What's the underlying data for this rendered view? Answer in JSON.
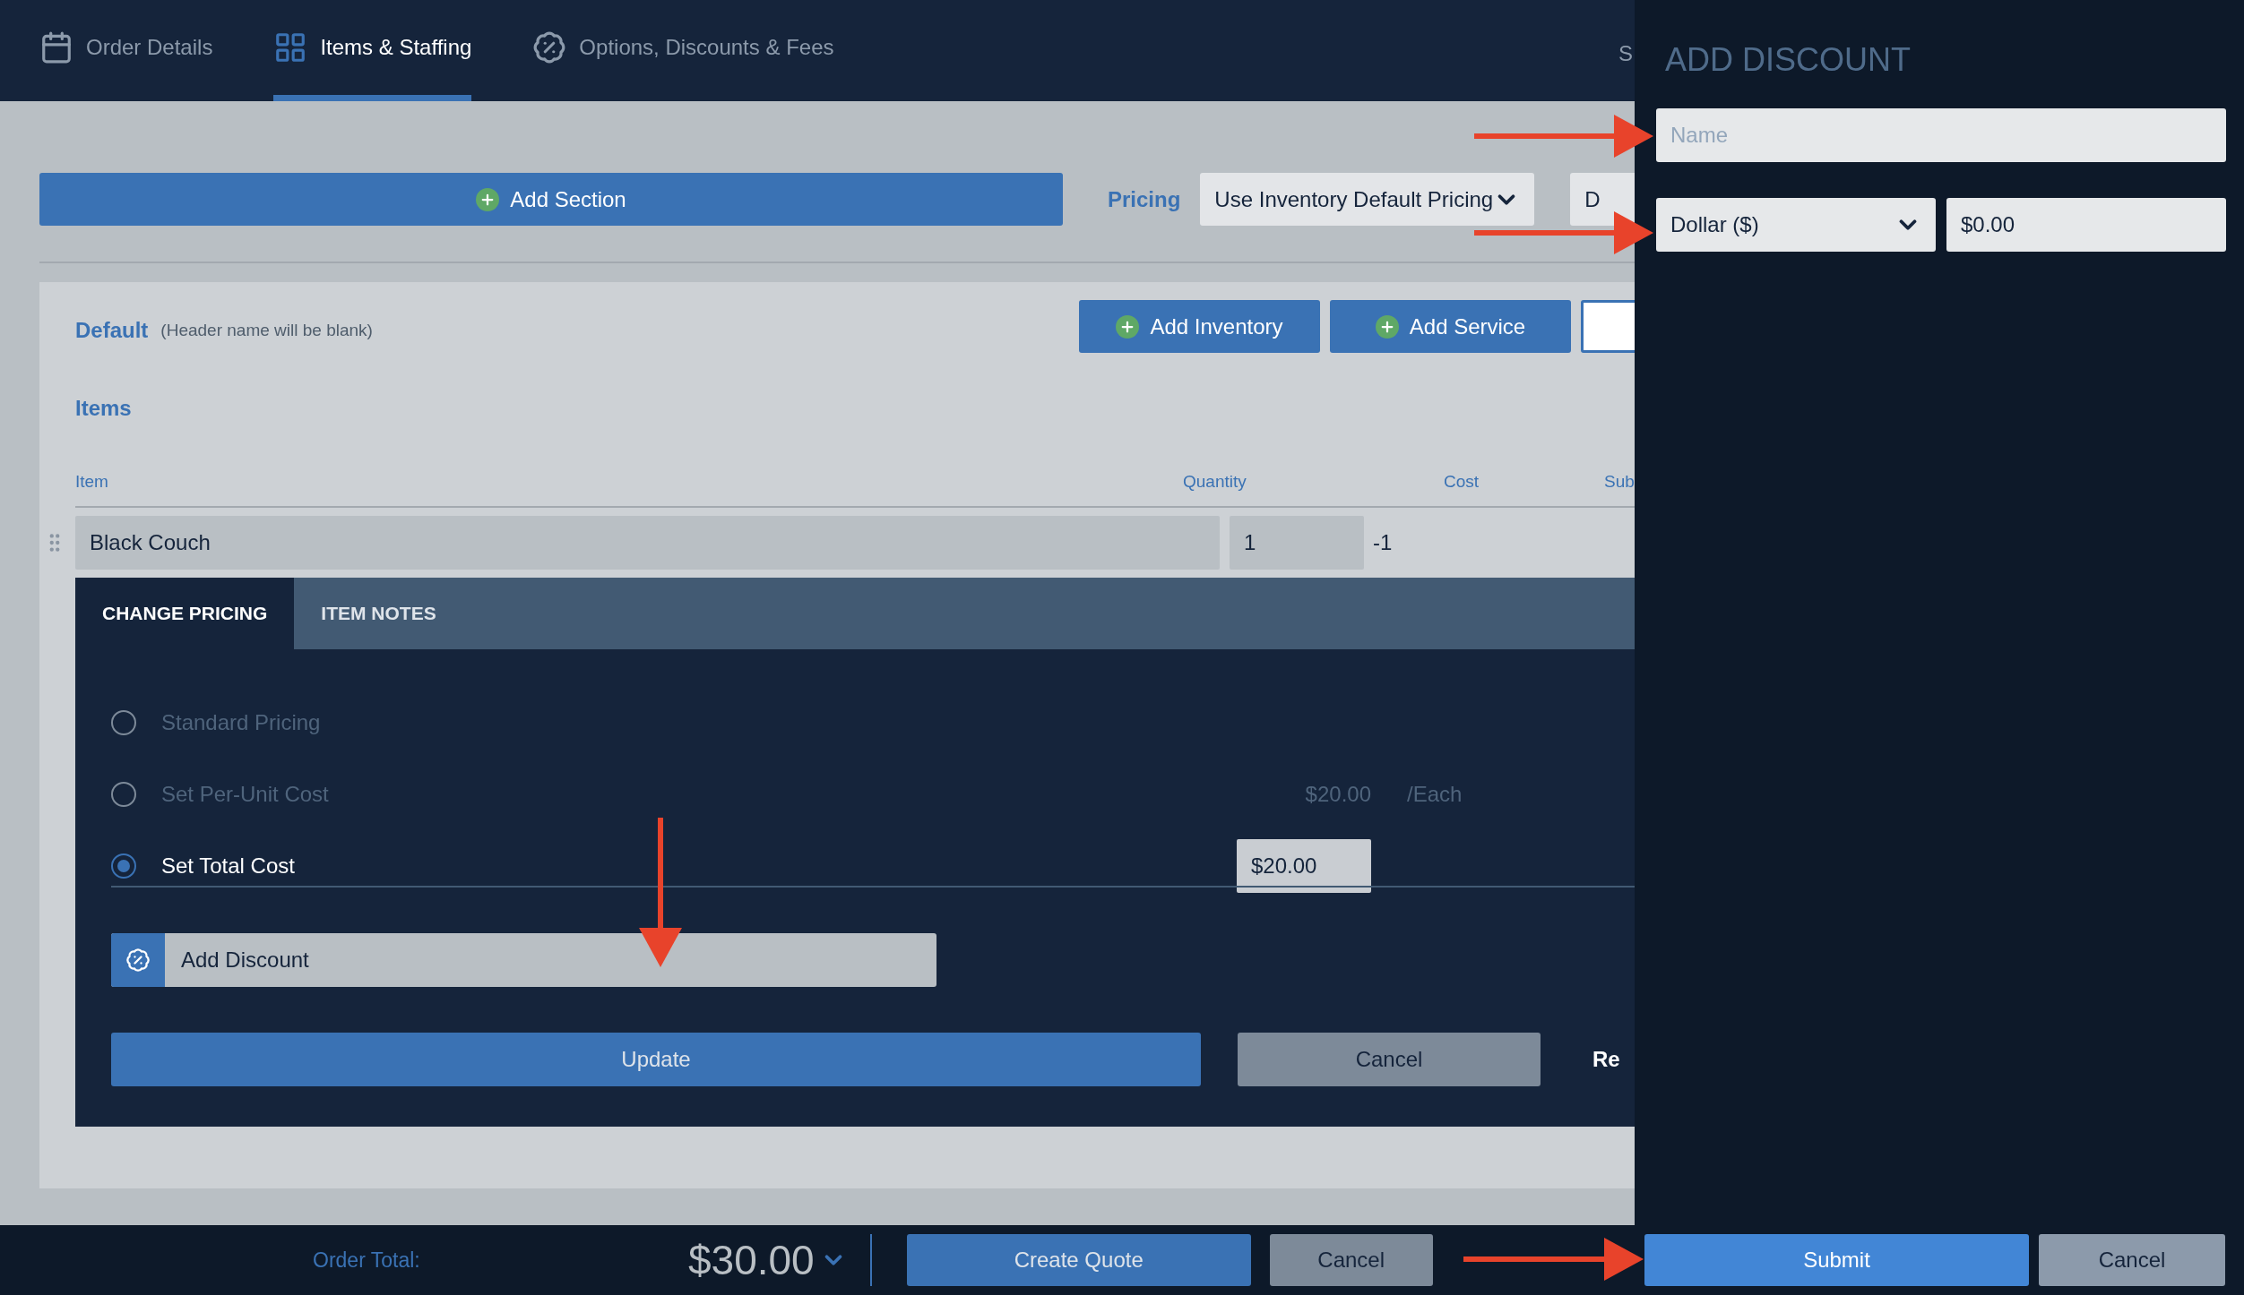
{
  "nav_tabs": [
    {
      "label": "Order Details",
      "selected": false
    },
    {
      "label": "Items & Staffing",
      "selected": true
    },
    {
      "label": "Options, Discounts & Fees",
      "selected": false
    }
  ],
  "nav_tab_cut": "S",
  "toolbar": {
    "add_section": "Add Section",
    "pricing_label": "Pricing",
    "pricing_select": "Use Inventory Default Pricing",
    "cut_box": "D"
  },
  "section": {
    "name": "Default",
    "note": "(Header name will be blank)",
    "buttons": [
      "Add Inventory",
      "Add Service"
    ],
    "items_heading": "Items",
    "columns": [
      "Item",
      "Quantity",
      "Cost",
      "Sub"
    ],
    "row": {
      "item": "Black Couch",
      "quantity": "1",
      "cost": "-1"
    }
  },
  "pricing_panel": {
    "tabs": [
      {
        "label": "CHANGE PRICING",
        "selected": true
      },
      {
        "label": "ITEM NOTES",
        "selected": false
      }
    ],
    "options": [
      {
        "label": "Standard Pricing",
        "selected": false
      },
      {
        "label": "Set Per-Unit Cost",
        "selected": false,
        "price": "$20.00",
        "unit": "/Each"
      },
      {
        "label": "Set Total Cost",
        "selected": true,
        "value": "$20.00"
      }
    ],
    "add_discount": "Add Discount",
    "update": "Update",
    "cancel": "Cancel",
    "cut_label": "Re"
  },
  "footer": {
    "order_total_label": "Order Total:",
    "order_total": "$30.00",
    "buttons": [
      "Create Quote",
      "Cancel"
    ]
  },
  "drawer": {
    "title": "ADD DISCOUNT",
    "name_placeholder": "Name",
    "type_select": "Dollar ($)",
    "amount": "$0.00",
    "buttons": [
      "Submit",
      "Cancel"
    ]
  }
}
